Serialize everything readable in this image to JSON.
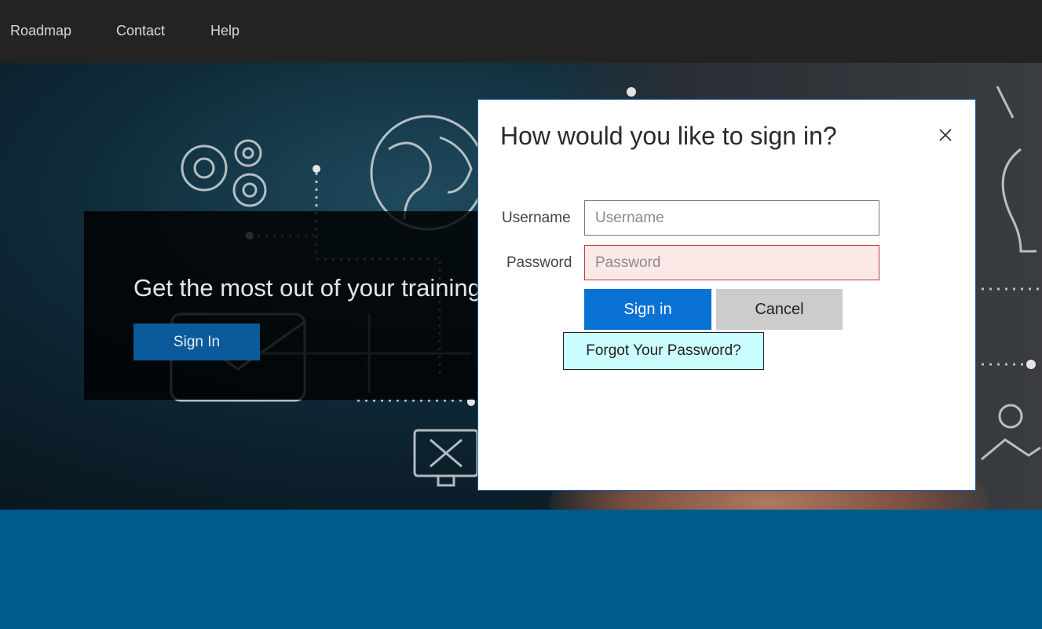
{
  "nav": {
    "items": [
      {
        "label": "Roadmap"
      },
      {
        "label": "Contact"
      },
      {
        "label": "Help"
      }
    ]
  },
  "hero": {
    "headline": "Get the most out of your training",
    "sign_in_label": "Sign In"
  },
  "dialog": {
    "title": "How would you like to sign in?",
    "close_icon": "close-icon",
    "username": {
      "label": "Username",
      "placeholder": "Username",
      "value": ""
    },
    "password": {
      "label": "Password",
      "placeholder": "Password",
      "value": ""
    },
    "sign_in_label": "Sign in",
    "cancel_label": "Cancel",
    "forgot_label": "Forgot Your Password?"
  },
  "colors": {
    "nav_bg": "#232323",
    "hero_button": "#0a5a9c",
    "primary": "#0a72d4",
    "page_bottom": "#005a8c",
    "password_error_bg": "#fde8e8",
    "forgot_bg": "#cbffff"
  },
  "icons": [
    "gears-icon",
    "globe-icon",
    "lightbulb-icon",
    "envelope-icon",
    "monitor-tools-icon",
    "map-pin-icon",
    "close-icon"
  ]
}
